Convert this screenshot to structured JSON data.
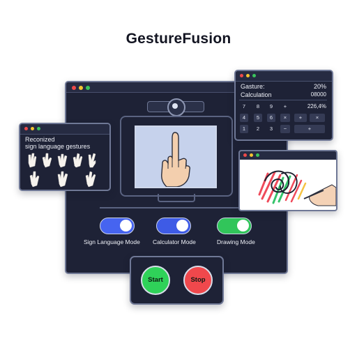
{
  "app": {
    "title": "GestureFusion"
  },
  "gestures_panel": {
    "title_line1": "Reconized",
    "title_line2": "sign language gestures"
  },
  "calculator": {
    "gesture_label": "Gasture:",
    "gesture_value": "20%",
    "calc_label": "Calculation",
    "calc_value": "08000",
    "result_value": "226,4%",
    "keys": [
      "7",
      "8",
      "9",
      "+",
      "4",
      "5",
      "6",
      "×",
      "1",
      "2",
      "3",
      "−",
      "0",
      "/",
      "·",
      "3",
      "−",
      "+"
    ],
    "side_keys": [
      "+",
      "×",
      "+"
    ]
  },
  "modes": [
    {
      "label": "Sign Language Mode",
      "color": "#4664f0",
      "state": "on"
    },
    {
      "label": "Calculator Mode",
      "color": "#3e5be6",
      "state": "on"
    },
    {
      "label": "Drawing Mode",
      "color": "#31c55a",
      "state": "on"
    }
  ],
  "controls": {
    "start_label": "Start",
    "stop_label": "Stop",
    "start_color": "#2fd259",
    "stop_color": "#f0484c"
  },
  "colors": {
    "window_bg": "#1e2236",
    "accent": "#6f7896"
  }
}
